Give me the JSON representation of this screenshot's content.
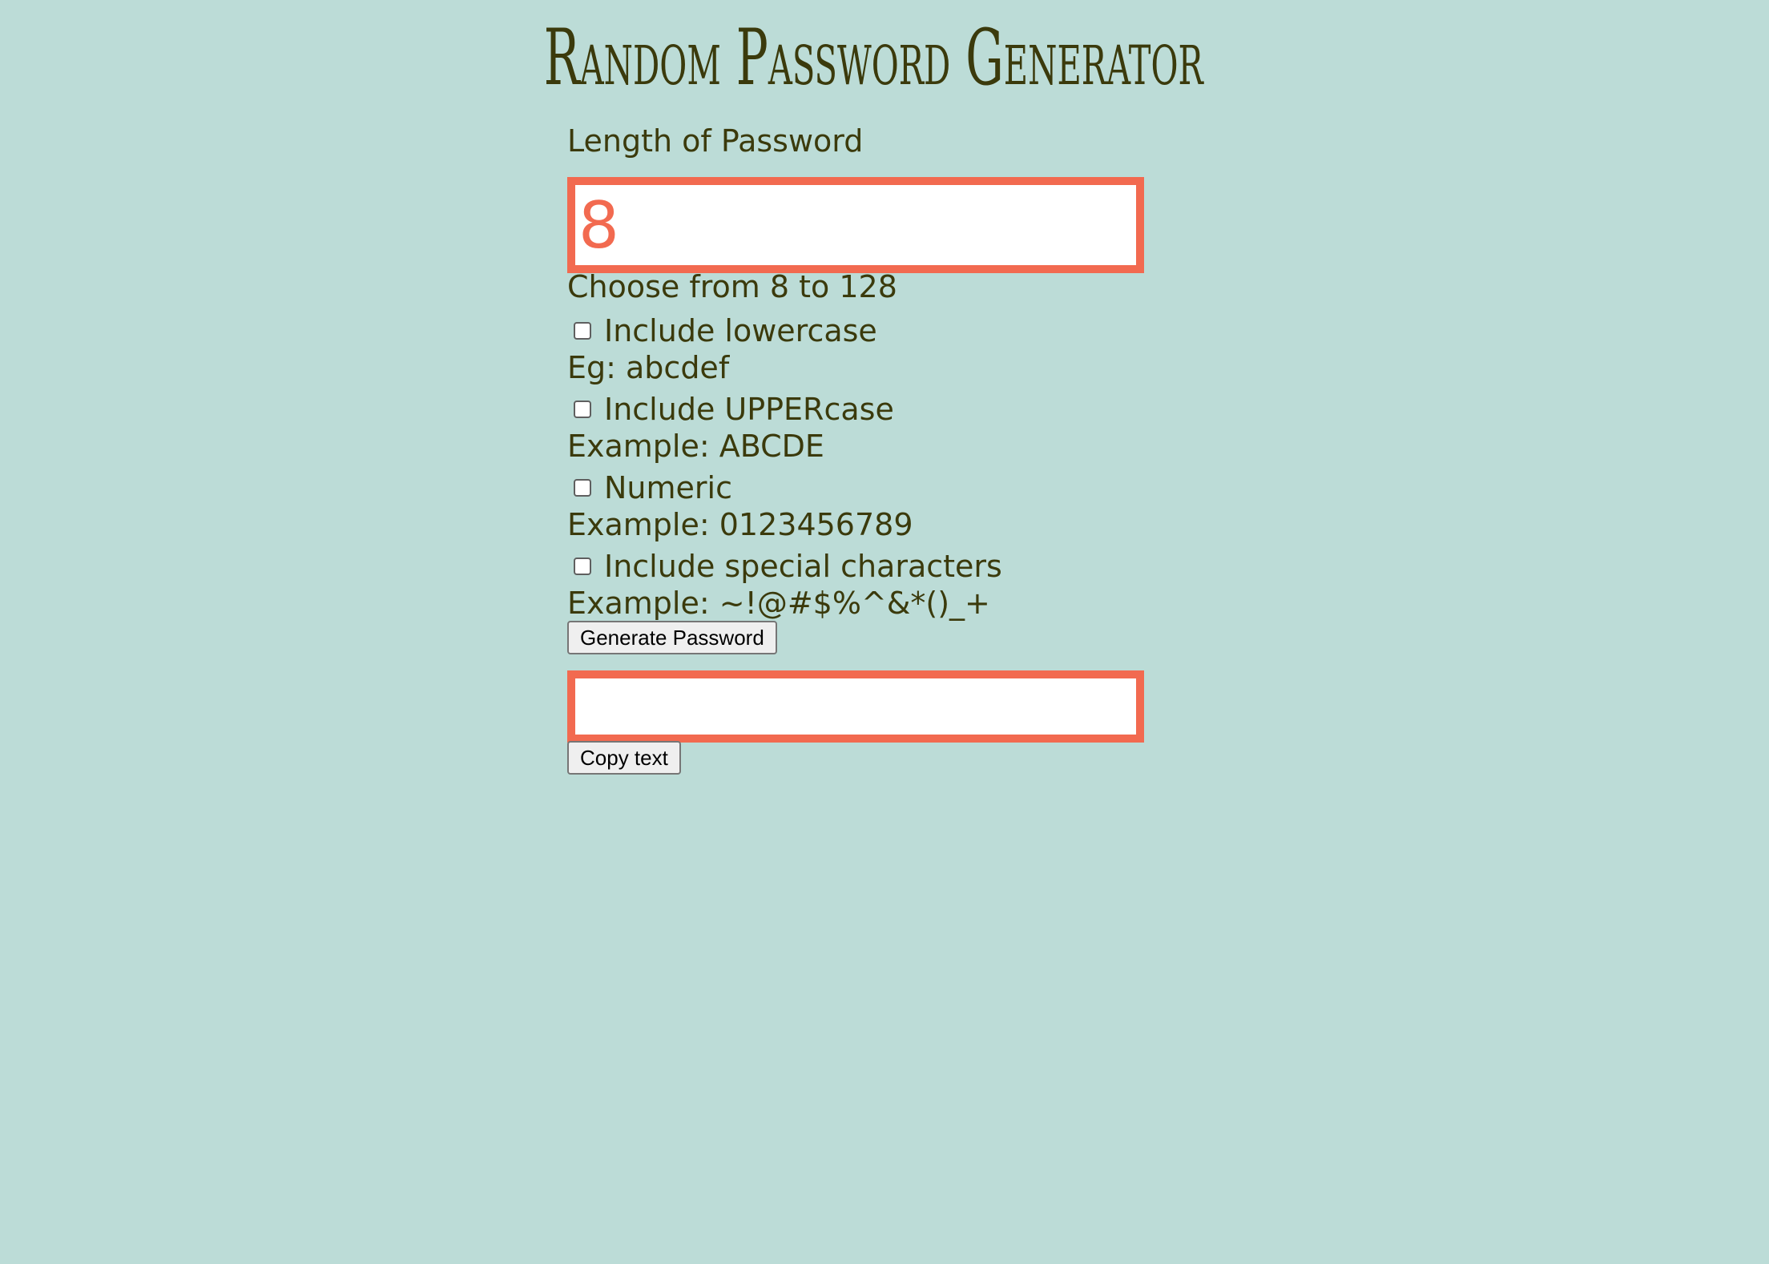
{
  "header": {
    "title": "Random Password Generator"
  },
  "length": {
    "label": "Length of Password",
    "value": "8",
    "hint": "Choose from 8 to 128"
  },
  "options": [
    {
      "label": "Include lowercase",
      "example": "Eg: abcdef",
      "checked": false
    },
    {
      "label": "Include UPPERcase",
      "example": "Example: ABCDE",
      "checked": false
    },
    {
      "label": "Numeric",
      "example": "Example: 0123456789",
      "checked": false
    },
    {
      "label": "Include special characters",
      "example": "Example: ~!@#$%^&*()_+",
      "checked": false
    }
  ],
  "actions": {
    "generate_label": "Generate Password",
    "copy_label": "Copy text"
  },
  "output": {
    "value": ""
  },
  "colors": {
    "background": "#bcdcd7",
    "text": "#3b3a0c",
    "accent": "#f26a50"
  }
}
